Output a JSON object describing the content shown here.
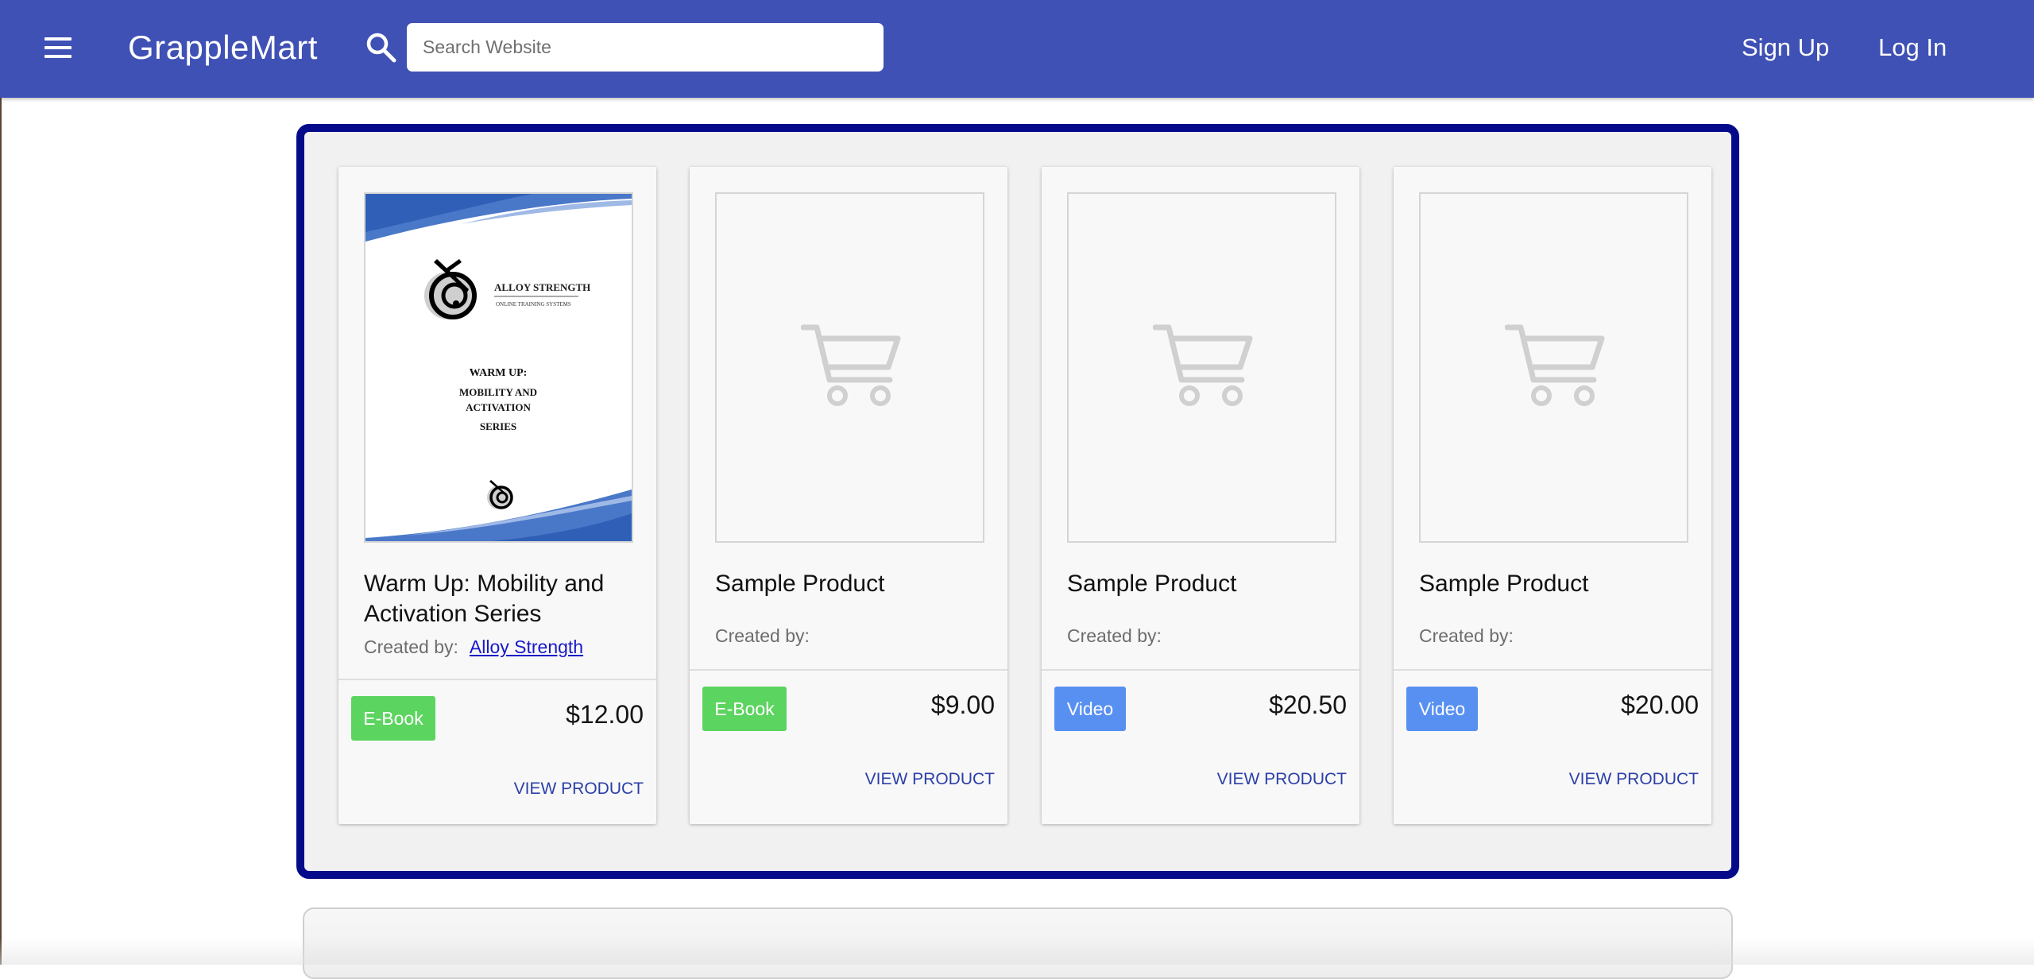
{
  "header": {
    "brand": "GrappleMart",
    "search_placeholder": "Search Website",
    "search_value": "",
    "signup_label": "Sign Up",
    "login_label": "Log In",
    "bar_color": "#3f51b5"
  },
  "products": [
    {
      "title": "Warm Up: Mobility and Activation Series",
      "created_by_label": "Created by:",
      "author": "Alloy Strength",
      "image": "ebook-cover",
      "cover": {
        "brand": "ALLOY STRENGTH",
        "tagline": "ONLINE TRAINING SYSTEMS",
        "lines": [
          "WARM UP:",
          "MOBILITY AND",
          "ACTIVATION",
          "SERIES"
        ]
      },
      "badge": "E-Book",
      "badge_color": "#5cd460",
      "price": "$12.00",
      "view_label": "VIEW PRODUCT"
    },
    {
      "title": "Sample Product",
      "created_by_label": "Created by:",
      "author": "",
      "image": "cart-icon",
      "badge": "E-Book",
      "badge_color": "#5cd460",
      "price": "$9.00",
      "view_label": "VIEW PRODUCT"
    },
    {
      "title": "Sample Product",
      "created_by_label": "Created by:",
      "author": "",
      "image": "cart-icon",
      "badge": "Video",
      "badge_color": "#5890f2",
      "price": "$20.50",
      "view_label": "VIEW PRODUCT"
    },
    {
      "title": "Sample Product",
      "created_by_label": "Created by:",
      "author": "",
      "image": "cart-icon",
      "badge": "Video",
      "badge_color": "#5890f2",
      "price": "$20.00",
      "view_label": "VIEW PRODUCT"
    }
  ],
  "colors": {
    "frame_border": "#050a8a",
    "link": "#2b3fa8"
  }
}
